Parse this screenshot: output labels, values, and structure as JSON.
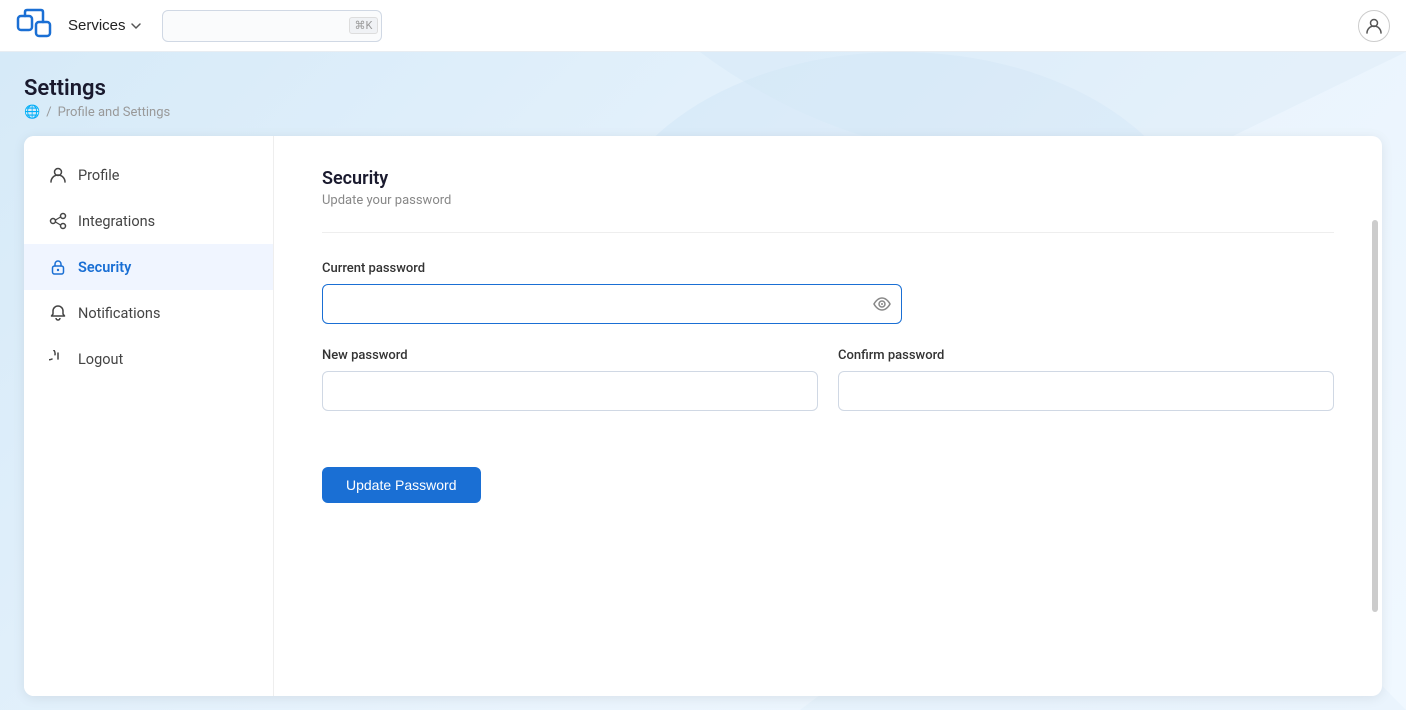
{
  "nav": {
    "services_label": "Services",
    "search_placeholder": "",
    "search_kbd": "⌘K"
  },
  "page": {
    "title": "Settings",
    "breadcrumb_home": "🌐",
    "breadcrumb_separator": "/",
    "breadcrumb_current": "Profile and Settings"
  },
  "sidebar": {
    "items": [
      {
        "id": "profile",
        "label": "Profile",
        "icon": "person-icon",
        "active": false
      },
      {
        "id": "integrations",
        "label": "Integrations",
        "icon": "integrations-icon",
        "active": false
      },
      {
        "id": "security",
        "label": "Security",
        "icon": "lock-icon",
        "active": true
      },
      {
        "id": "notifications",
        "label": "Notifications",
        "icon": "bell-icon",
        "active": false
      },
      {
        "id": "logout",
        "label": "Logout",
        "icon": "power-icon",
        "active": false
      }
    ]
  },
  "security": {
    "title": "Security",
    "subtitle": "Update your password",
    "current_password_label": "Current password",
    "current_password_placeholder": "",
    "new_password_label": "New password",
    "new_password_placeholder": "",
    "confirm_password_label": "Confirm password",
    "confirm_password_placeholder": "",
    "update_button": "Update Password"
  }
}
